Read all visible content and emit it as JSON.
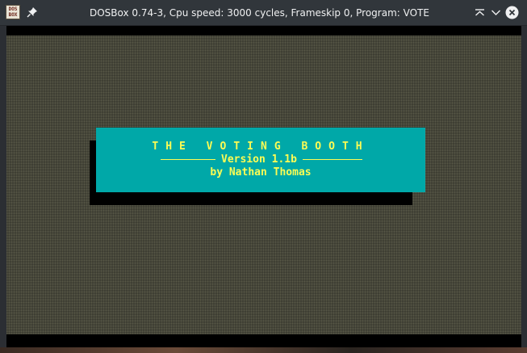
{
  "window": {
    "title": "DOSBox 0.74-3, Cpu speed: 3000 cycles, Frameskip 0, Program: VOTE",
    "app_icon_text": "DOS\nBOX",
    "icons": {
      "app": "dosbox-app-icon",
      "pin": "pin-icon",
      "keep_above": "chevron-up-icon",
      "minimize": "chevron-down-icon",
      "close": "close-icon"
    }
  },
  "screen": {
    "title": "THE VOTING BOOTH",
    "version": "Version 1.1b",
    "author": "by Nathan Thomas"
  },
  "colors": {
    "panel": "#00a8a8",
    "text": "#fcfc54",
    "shadow": "#000000",
    "background": "#4d4d40",
    "titlebar": "#31363b"
  }
}
